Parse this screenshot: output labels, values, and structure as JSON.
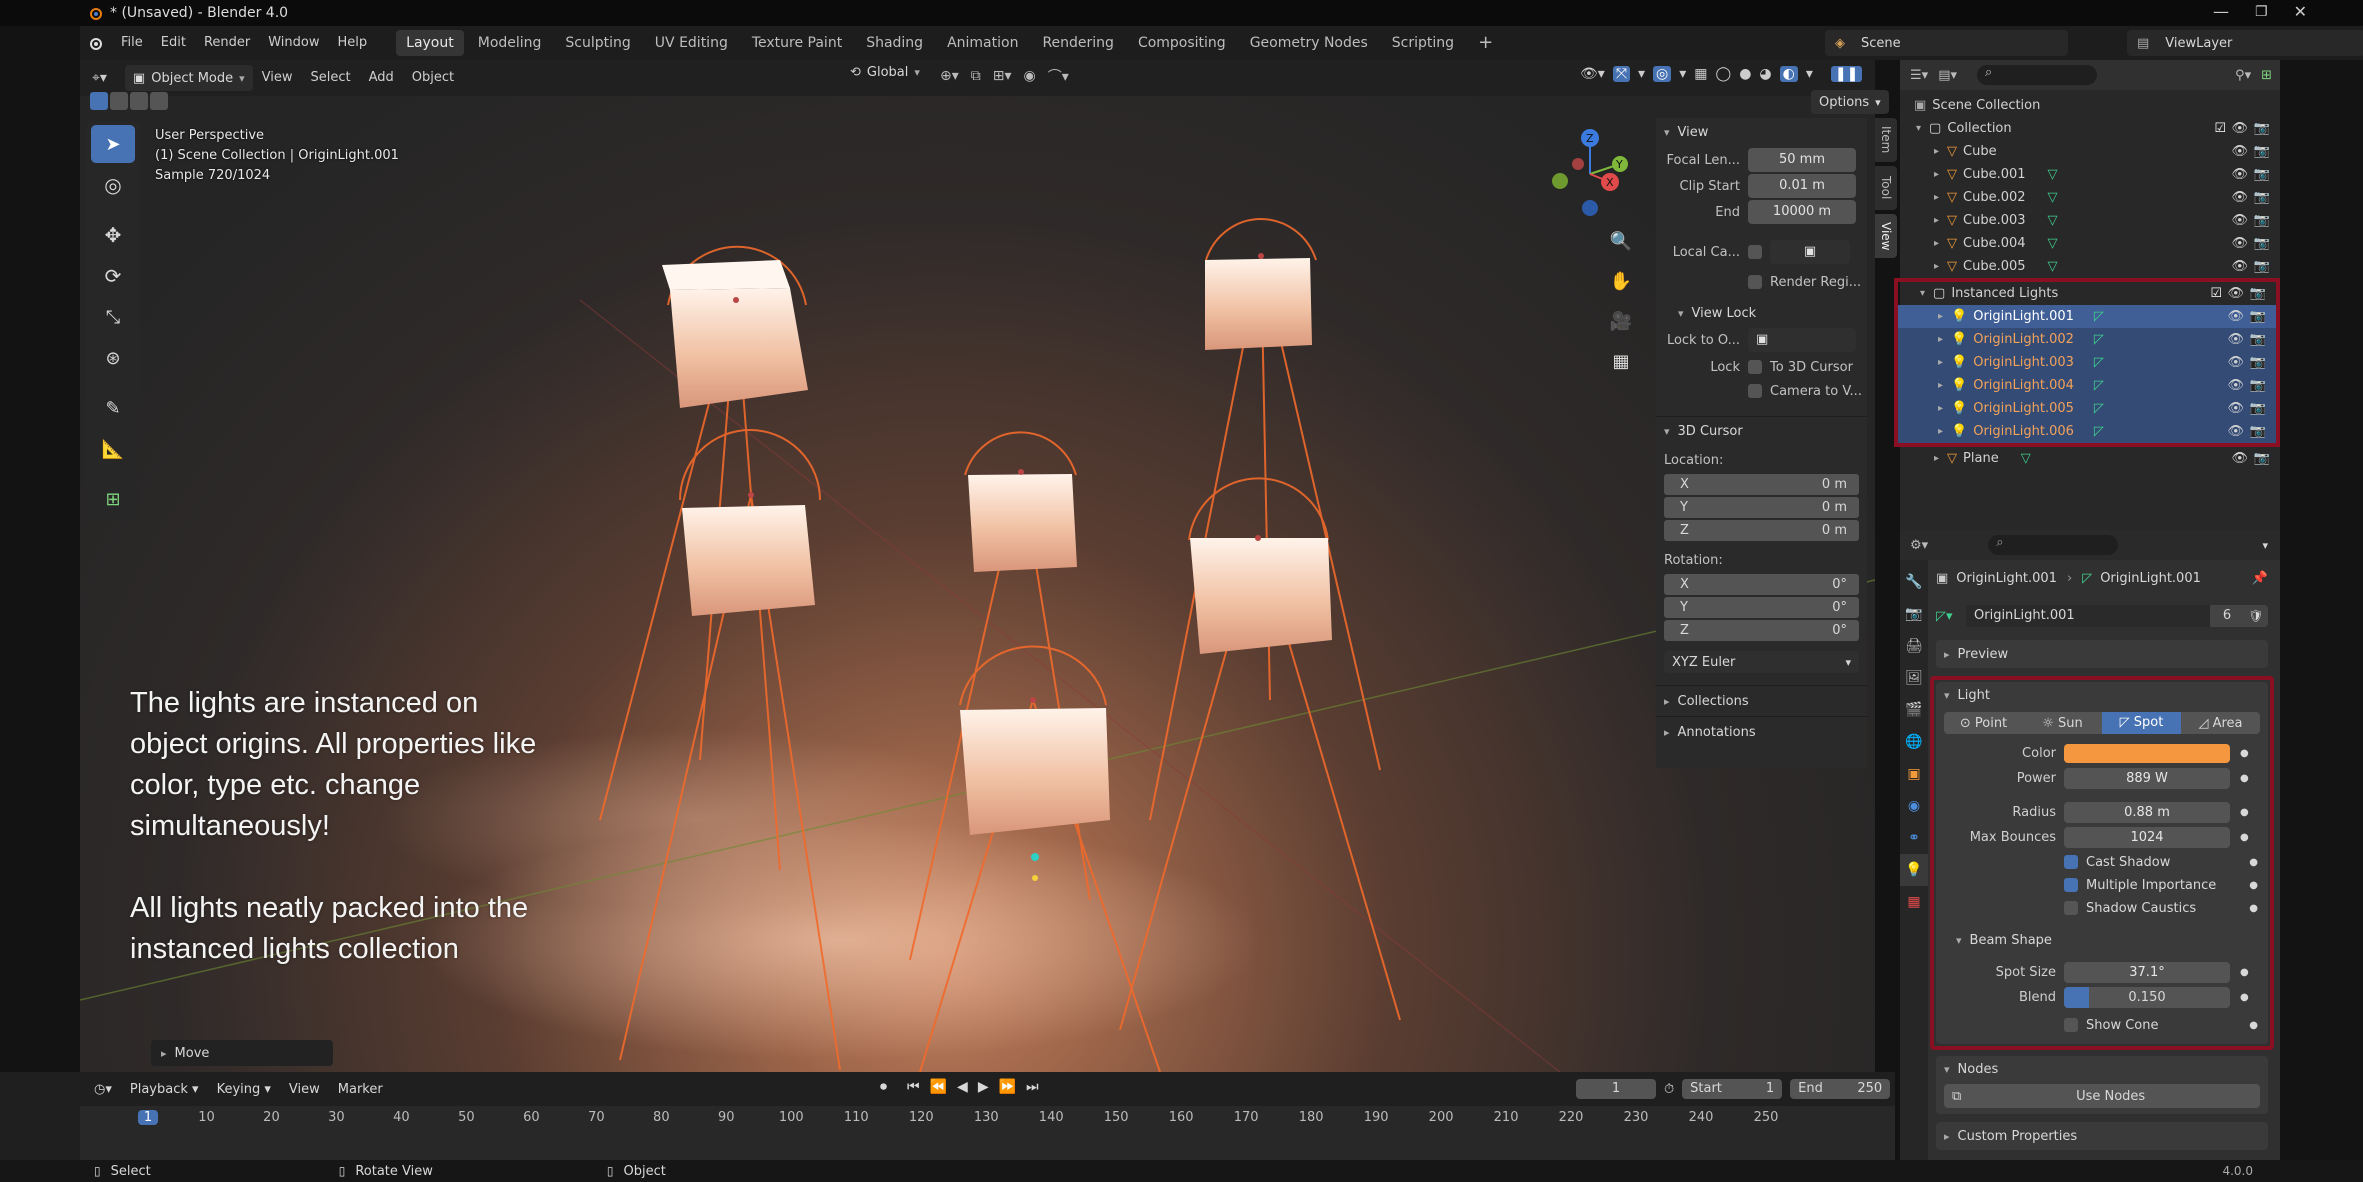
{
  "title": "* (Unsaved) - Blender 4.0",
  "menu": [
    "File",
    "Edit",
    "Render",
    "Window",
    "Help"
  ],
  "workspaces": [
    "Layout",
    "Modeling",
    "Sculpting",
    "UV Editing",
    "Texture Paint",
    "Shading",
    "Animation",
    "Rendering",
    "Compositing",
    "Geometry Nodes",
    "Scripting"
  ],
  "active_workspace": "Layout",
  "scene_name": "Scene",
  "view_layer": "ViewLayer",
  "viewport_header": {
    "mode": "Object Mode",
    "view": "View",
    "select": "Select",
    "add": "Add",
    "object": "Object",
    "orientation": "Global",
    "options": "Options"
  },
  "overlay_info": {
    "line1": "User Perspective",
    "line2": "(1) Scene Collection | OriginLight.001",
    "line3": "Sample 720/1024"
  },
  "caption": {
    "p1_lines": [
      "The lights are instanced on",
      "object origins. All properties like",
      "color, type etc. change",
      "simultaneously!"
    ],
    "p2_lines": [
      "All lights neatly packed into the",
      "instanced lights collection"
    ]
  },
  "last_operator": "Move",
  "npanel": {
    "tabs": [
      "Item",
      "Tool",
      "View"
    ],
    "view_header": "View",
    "focal_label": "Focal Len...",
    "focal_value": "50 mm",
    "clip_start_label": "Clip Start",
    "clip_start_value": "0.01 m",
    "end_label": "End",
    "end_value": "10000 m",
    "local_cam_label": "Local Ca...",
    "render_region_label": "Render Regi...",
    "view_lock_header": "View Lock",
    "lock_to_label": "Lock to O...",
    "lock_label": "Lock",
    "to_cursor_label": "To 3D Cursor",
    "camera_to_view_label": "Camera to V...",
    "cursor_header": "3D Cursor",
    "location_label": "Location:",
    "location": [
      {
        "axis": "X",
        "value": "0 m"
      },
      {
        "axis": "Y",
        "value": "0 m"
      },
      {
        "axis": "Z",
        "value": "0 m"
      }
    ],
    "rotation_label": "Rotation:",
    "rotation": [
      {
        "axis": "X",
        "value": "0°"
      },
      {
        "axis": "Y",
        "value": "0°"
      },
      {
        "axis": "Z",
        "value": "0°"
      }
    ],
    "rotation_mode": "XYZ Euler",
    "collections_header": "Collections",
    "annotations_header": "Annotations"
  },
  "outliner": {
    "root": "Scene Collection",
    "collection": "Collection",
    "cubes": [
      "Cube",
      "Cube.001",
      "Cube.002",
      "Cube.003",
      "Cube.004",
      "Cube.005"
    ],
    "instanced": "Instanced Lights",
    "lights": [
      "OriginLight.001",
      "OriginLight.002",
      "OriginLight.003",
      "OriginLight.004",
      "OriginLight.005",
      "OriginLight.006"
    ],
    "plane": "Plane"
  },
  "properties": {
    "breadcrumb_obj": "OriginLight.001",
    "breadcrumb_data": "OriginLight.001",
    "datablock_name": "OriginLight.001",
    "users": "6",
    "preview_header": "Preview",
    "light_header": "Light",
    "light_types": [
      "Point",
      "Sun",
      "Spot",
      "Area"
    ],
    "active_type": "Spot",
    "color_label": "Color",
    "color_value": "#f5973f",
    "power_label": "Power",
    "power_value": "889 W",
    "radius_label": "Radius",
    "radius_value": "0.88 m",
    "bounces_label": "Max Bounces",
    "bounces_value": "1024",
    "cast_shadow": "Cast Shadow",
    "multiple_importance": "Multiple Importance",
    "shadow_caustics": "Shadow Caustics",
    "beam_header": "Beam Shape",
    "spot_size_label": "Spot Size",
    "spot_size_value": "37.1°",
    "blend_label": "Blend",
    "blend_value": "0.150",
    "blend_fraction": 0.15,
    "show_cone": "Show Cone",
    "nodes_header": "Nodes",
    "use_nodes": "Use Nodes",
    "custom_header": "Custom Properties"
  },
  "timeline": {
    "playback": "Playback",
    "keying": "Keying",
    "view": "View",
    "marker": "Marker",
    "current_frame": "1",
    "start_label": "Start",
    "start": "1",
    "end_label": "End",
    "end": "250",
    "ticks": [
      "1",
      "10",
      "20",
      "30",
      "40",
      "50",
      "60",
      "70",
      "80",
      "90",
      "100",
      "110",
      "120",
      "130",
      "140",
      "150",
      "160",
      "170",
      "180",
      "190",
      "200",
      "210",
      "220",
      "230",
      "240",
      "250"
    ]
  },
  "status": {
    "select": "Select",
    "rotate": "Rotate View",
    "object": "Object",
    "version": "4.0.0"
  },
  "colors": {
    "accent_blue": "#4772b3",
    "highlight_red": "#8b0f23",
    "light_orange": "#f5973f",
    "selection": "#334b75"
  }
}
